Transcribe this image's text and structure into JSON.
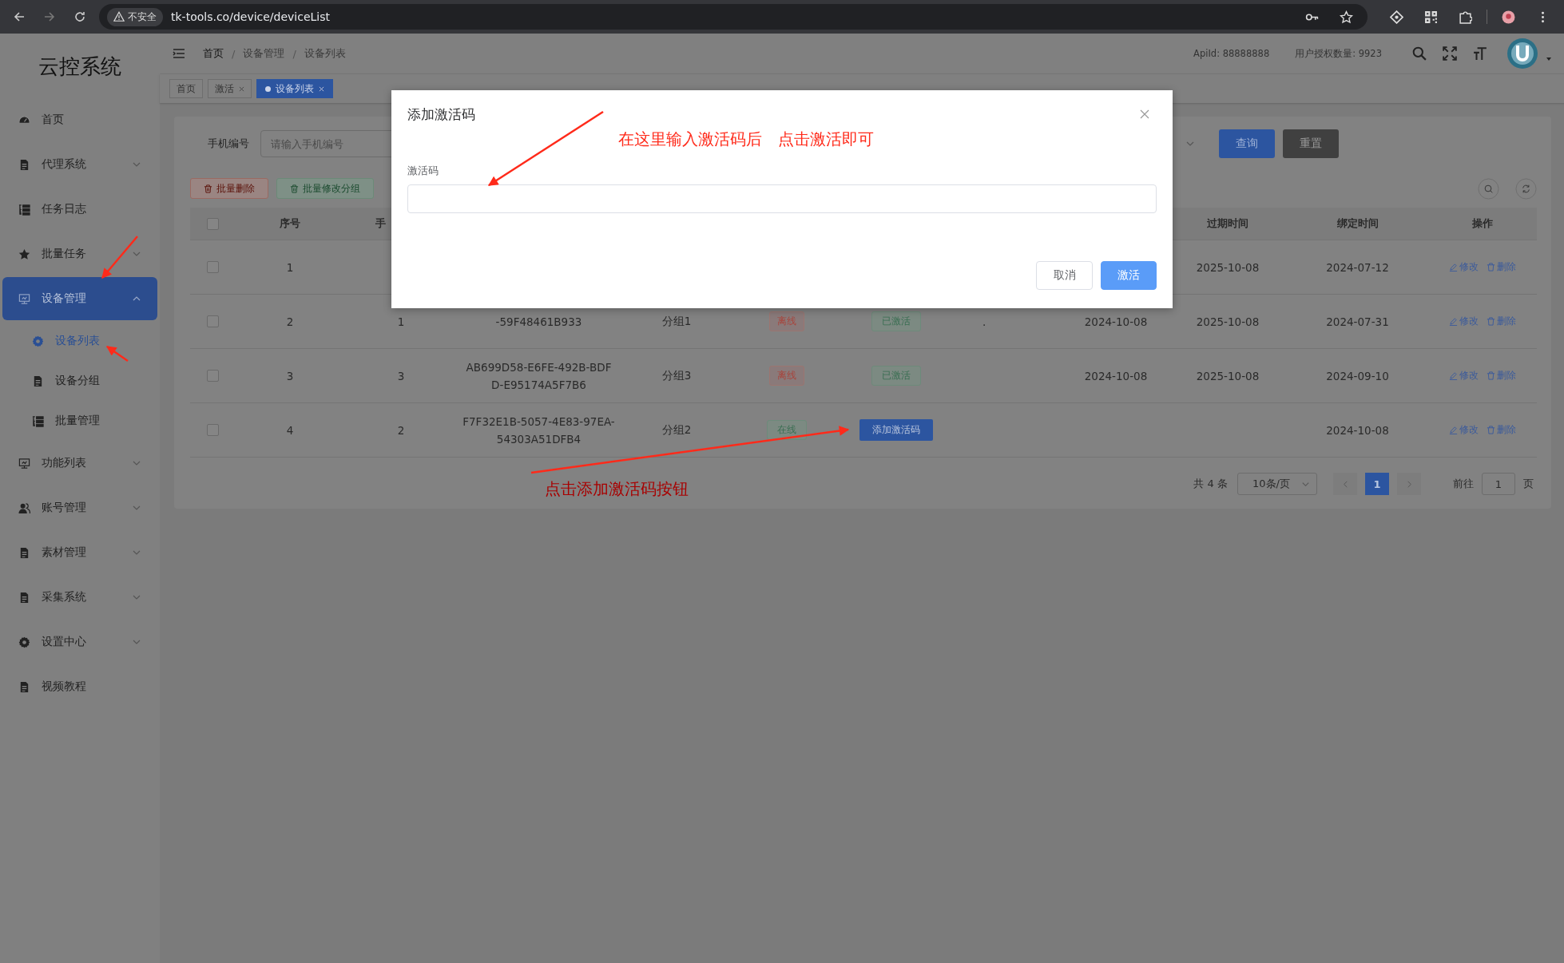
{
  "browser": {
    "security": "不安全",
    "url": "tk-tools.co/device/deviceList"
  },
  "sidebar": {
    "title": "云控系统",
    "items": [
      {
        "label": "首页",
        "kind": "link"
      },
      {
        "label": "代理系统",
        "kind": "menu",
        "expanded": false
      },
      {
        "label": "任务日志",
        "kind": "link"
      },
      {
        "label": "批量任务",
        "kind": "menu",
        "expanded": false
      },
      {
        "label": "设备管理",
        "kind": "menu",
        "expanded": true,
        "selected": true,
        "children": [
          {
            "label": "设备列表",
            "selected": true
          },
          {
            "label": "设备分组",
            "selected": false
          },
          {
            "label": "批量管理",
            "selected": false
          }
        ]
      },
      {
        "label": "功能列表",
        "kind": "menu",
        "expanded": false
      },
      {
        "label": "账号管理",
        "kind": "menu",
        "expanded": false
      },
      {
        "label": "素材管理",
        "kind": "menu",
        "expanded": false
      },
      {
        "label": "采集系统",
        "kind": "menu",
        "expanded": false
      },
      {
        "label": "设置中心",
        "kind": "menu",
        "expanded": false
      },
      {
        "label": "视频教程",
        "kind": "link"
      }
    ]
  },
  "header": {
    "breadcrumb": [
      "首页",
      "设备管理",
      "设备列表"
    ],
    "breadcrumb_separator": "/",
    "api_id": "ApiId: 88888888",
    "license_count": "用户授权数量: 9923"
  },
  "tabs": [
    {
      "label": "首页",
      "selected": false,
      "closable": false
    },
    {
      "label": "激活",
      "selected": false,
      "closable": true
    },
    {
      "label": "设备列表",
      "selected": true,
      "closable": true
    }
  ],
  "filter": {
    "label": "手机编号",
    "placeholder": "请输入手机编号",
    "buttons": [
      {
        "label": "查询",
        "kind": "primary"
      },
      {
        "label": "重置",
        "kind": "dark"
      }
    ]
  },
  "toolbar": [
    {
      "label": "批量删除",
      "kind": "danger"
    },
    {
      "label": "批量修改分组",
      "kind": "success"
    }
  ],
  "table": {
    "header_checked": false,
    "columns": [
      {
        "label": "序号"
      },
      {
        "label": "手"
      },
      {
        "label": "过期时间"
      },
      {
        "label": "绑定时间"
      },
      {
        "label": "操作"
      }
    ],
    "rows": [
      {
        "checked": false,
        "seq": "1",
        "expire": "2025-10-08",
        "bind": "2024-07-12",
        "actions": [
          "修改",
          "删除"
        ]
      },
      {
        "checked": false,
        "seq": "2",
        "phone": "1",
        "device": [
          "-59F48461B933"
        ],
        "group": "分组1",
        "status": {
          "text": "离线",
          "kind": "offline"
        },
        "activation": {
          "kind": "tag",
          "text": "已激活"
        },
        "remark": ".",
        "activated": "2024-10-08",
        "expire": "2025-10-08",
        "bind": "2024-07-31",
        "actions": [
          "修改",
          "删除"
        ]
      },
      {
        "checked": false,
        "seq": "3",
        "phone": "3",
        "device": [
          "AB699D58-E6FE-492B-BDF",
          "D-E95174A5F7B6"
        ],
        "group": "分组3",
        "status": {
          "text": "离线",
          "kind": "offline"
        },
        "activation": {
          "kind": "tag",
          "text": "已激活"
        },
        "activated": "2024-10-08",
        "expire": "2025-10-08",
        "bind": "2024-09-10",
        "actions": [
          "修改",
          "删除"
        ]
      },
      {
        "checked": false,
        "seq": "4",
        "phone": "2",
        "device": [
          "F7F32E1B-5057-4E83-97EA-",
          "54303A51DFB4"
        ],
        "group": "分组2",
        "status": {
          "text": "在线",
          "kind": "online"
        },
        "activation": {
          "kind": "button",
          "text": "添加激活码"
        },
        "bind": "2024-10-08",
        "actions": [
          "修改",
          "删除"
        ]
      }
    ]
  },
  "pagination": {
    "total": "共 4 条",
    "page_size": "10条/页",
    "pages": [
      {
        "label": "1",
        "selected": true
      }
    ],
    "goto_label": "前往",
    "goto_value": "1",
    "page_suffix": "页"
  },
  "modal": {
    "title": "添加激活码",
    "field_label": "激活码",
    "buttons": [
      {
        "label": "取消",
        "kind": "default"
      },
      {
        "label": "激活",
        "kind": "primary"
      }
    ]
  },
  "annotations": [
    {
      "text": "在这里输入激活码后　点击激活即可"
    },
    {
      "text": "点击添加激活码按钮"
    }
  ]
}
